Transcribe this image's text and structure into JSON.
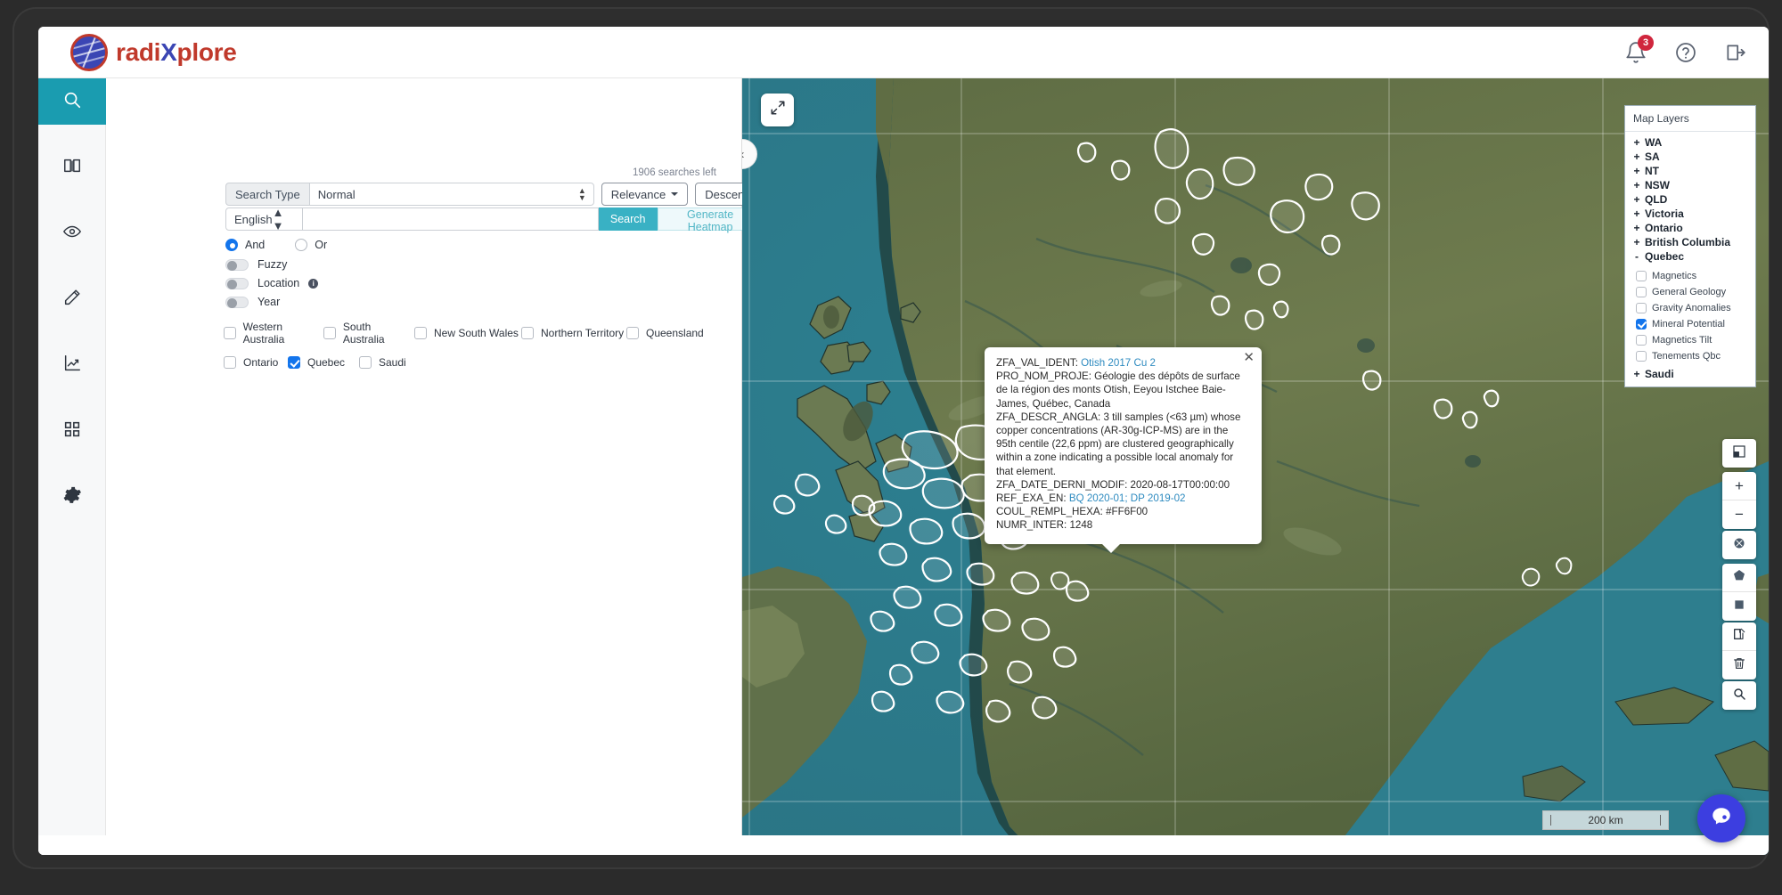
{
  "app": {
    "brand_prefix": "radi",
    "brand_mid": "X",
    "brand_suffix": "plore",
    "logo_icon": "globe-grid-icon"
  },
  "header": {
    "notifications_badge": "3",
    "bell_icon": "bell-icon",
    "help_icon": "question-circle-icon",
    "logout_icon": "logout-icon"
  },
  "rail": {
    "items": [
      {
        "name": "search",
        "icon": "magnifier-icon",
        "active": true
      },
      {
        "name": "library",
        "icon": "book-icon",
        "active": false
      },
      {
        "name": "watch",
        "icon": "eye-icon",
        "active": false
      },
      {
        "name": "annotate",
        "icon": "pencil-icon",
        "active": false
      },
      {
        "name": "analytics",
        "icon": "line-chart-icon",
        "active": false
      },
      {
        "name": "apps",
        "icon": "grid-squares-icon",
        "active": false
      },
      {
        "name": "settings",
        "icon": "gear-icon",
        "active": false
      }
    ]
  },
  "search_panel": {
    "searches_left": "1906 searches left",
    "search_type_label": "Search Type",
    "search_type_value": "Normal",
    "search_type_options": [
      "Normal"
    ],
    "relevance_label": "Relevance",
    "sort_label": "Descending",
    "filter_icon": "funnel-icon",
    "language_value": "English",
    "query_value": "",
    "query_placeholder": "",
    "search_button": "Search",
    "heatmap_button": "Generate Heatmap",
    "operator": {
      "and_label": "And",
      "or_label": "Or",
      "selected": "And"
    },
    "toggles": [
      {
        "label": "Fuzzy",
        "on": false,
        "info": false
      },
      {
        "label": "Location",
        "on": false,
        "info": true
      },
      {
        "label": "Year",
        "on": false,
        "info": false
      }
    ],
    "regions_row1": [
      {
        "label": "Western Australia",
        "checked": false
      },
      {
        "label": "South Australia",
        "checked": false
      },
      {
        "label": "New South Wales",
        "checked": false
      },
      {
        "label": "Northern Territory",
        "checked": false
      },
      {
        "label": "Queensland",
        "checked": false
      }
    ],
    "regions_row2": [
      {
        "label": "Ontario",
        "checked": false
      },
      {
        "label": "Quebec",
        "checked": true
      },
      {
        "label": "Saudi",
        "checked": false
      }
    ]
  },
  "map": {
    "collapse_icon": "chevron-left-icon",
    "fullscreen_icon": "expand-arrows-icon",
    "scale_label": "200 km",
    "chat_icon": "chat-bubble-icon",
    "layers": {
      "title": "Map Layers",
      "groups": [
        {
          "sign": "+",
          "label": "WA"
        },
        {
          "sign": "+",
          "label": "SA"
        },
        {
          "sign": "+",
          "label": "NT"
        },
        {
          "sign": "+",
          "label": "NSW"
        },
        {
          "sign": "+",
          "label": "QLD"
        },
        {
          "sign": "+",
          "label": "Victoria"
        },
        {
          "sign": "+",
          "label": "Ontario"
        },
        {
          "sign": "+",
          "label": "British Columbia"
        },
        {
          "sign": "-",
          "label": "Quebec"
        }
      ],
      "quebec_layers": [
        {
          "label": "Magnetics",
          "checked": false
        },
        {
          "label": "General Geology",
          "checked": false
        },
        {
          "label": "Gravity Anomalies",
          "checked": false
        },
        {
          "label": "Mineral Potential",
          "checked": true
        },
        {
          "label": "Magnetics Tilt",
          "checked": false
        },
        {
          "label": "Tenements Qbc",
          "checked": false
        }
      ],
      "trailing_group": {
        "sign": "+",
        "label": "Saudi"
      }
    },
    "tools": [
      {
        "name": "basemap-layers",
        "icon": "layers-square-icon"
      },
      {
        "name": "zoom-in",
        "icon": "plus-icon",
        "glyph": "+"
      },
      {
        "name": "zoom-out",
        "icon": "minus-icon",
        "glyph": "−"
      },
      {
        "name": "locate-me",
        "icon": "crosshair-icon"
      },
      {
        "name": "draw-polygon",
        "icon": "pentagon-icon"
      },
      {
        "name": "draw-rectangle",
        "icon": "square-icon"
      },
      {
        "name": "edit-shape",
        "icon": "edit-square-icon"
      },
      {
        "name": "delete-shape",
        "icon": "trash-icon"
      },
      {
        "name": "search-map",
        "icon": "magnifier-icon"
      }
    ]
  },
  "popup": {
    "close_icon": "close-icon",
    "lines": [
      {
        "key": "ZFA_VAL_IDENT: ",
        "value": "Otish 2017 Cu 2",
        "link": true
      },
      {
        "key": "PRO_NOM_PROJE: ",
        "value": "Géologie des dépôts de surface de la région des monts Otish, Eeyou Istchee Baie-James, Québec, Canada",
        "link": false
      },
      {
        "key": "ZFA_DESCR_ANGLA: ",
        "value": "3 till samples (<63 µm) whose copper concentrations (AR-30g-ICP-MS) are in the 95th centile (22,6 ppm) are clustered geographically within a zone indicating a possible local anomaly for that element.",
        "link": false
      },
      {
        "key": "ZFA_DATE_DERNI_MODIF: ",
        "value": "2020-08-17T00:00:00",
        "link": false
      },
      {
        "key": "REF_EXA_EN: ",
        "value": "BQ 2020-01; DP 2019-02",
        "link": true
      },
      {
        "key": "COUL_REMPL_HEXA: ",
        "value": "#FF6F00",
        "link": false
      },
      {
        "key": "NUMR_INTER: ",
        "value": "1248",
        "link": false
      }
    ]
  },
  "colors": {
    "accent_teal": "#1a9cb0",
    "brand_red": "#c0392b",
    "brand_blue": "#3b46b4",
    "checkbox_blue": "#1375ec",
    "badge_red": "#d0263d",
    "feature_fill": "#FF6F00",
    "water": "#2f7f8e",
    "land": "#6d7a4c"
  }
}
